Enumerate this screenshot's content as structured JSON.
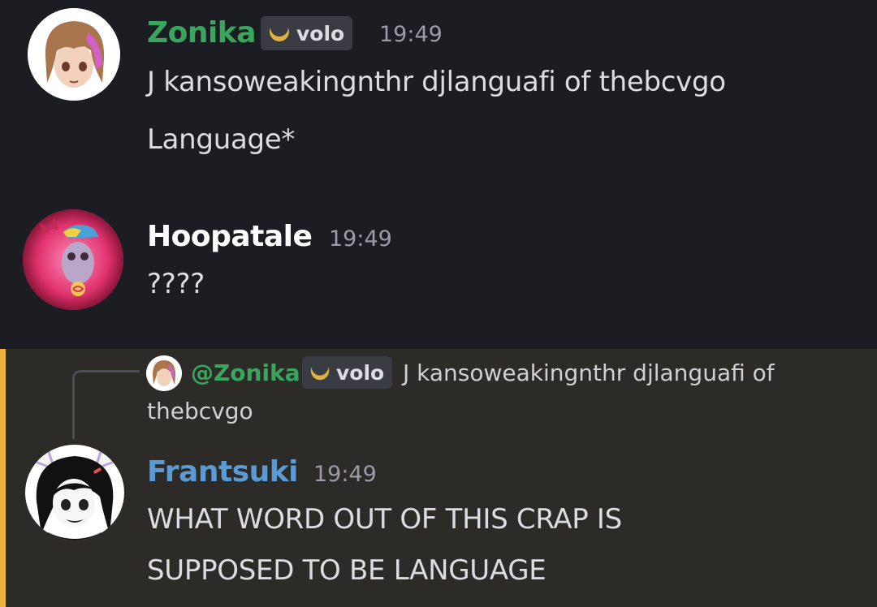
{
  "messages": [
    {
      "author": "Zonika",
      "author_color": "#3aa55d",
      "tag": "volo",
      "time": "19:49",
      "lines": [
        "J kansoweakingnthr djlanguafi of thebcvgo",
        "Language*"
      ]
    },
    {
      "author": "Hoopatale",
      "author_color": "#ffffff",
      "time": "19:49",
      "lines": [
        "????"
      ]
    },
    {
      "reply": {
        "mention": "@Zonika",
        "tag": "volo",
        "text_line1": "J kansoweakingnthr djlanguafi of",
        "text_line2": "thebcvgo"
      },
      "author": "Frantsuki",
      "author_color": "#5b9bd5",
      "time": "19:49",
      "lines": [
        "WHAT WORD OUT OF THIS CRAP IS",
        "SUPPOSED TO BE LANGUAGE"
      ],
      "highlight_color": "#e8b23c"
    }
  ]
}
